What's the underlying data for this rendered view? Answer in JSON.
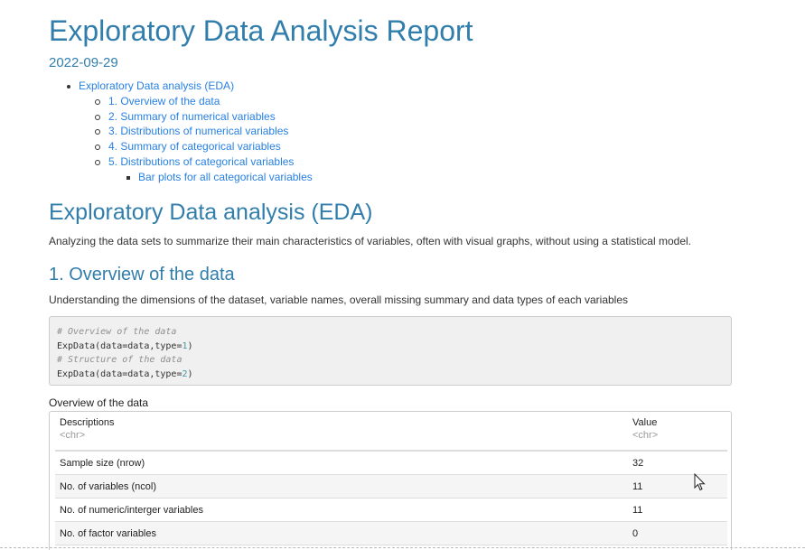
{
  "report": {
    "title": "Exploratory Data Analysis Report",
    "date": "2022-09-29"
  },
  "toc": {
    "top": "Exploratory Data analysis (EDA)",
    "items": [
      "1. Overview of the data",
      "2. Summary of numerical variables",
      "3. Distributions of numerical variables",
      "4. Summary of categorical variables",
      "5. Distributions of categorical variables"
    ],
    "sub": "Bar plots for all categorical variables"
  },
  "eda": {
    "heading": "Exploratory Data analysis (EDA)",
    "description": "Analyzing the data sets to summarize their main characteristics of variables, often with visual graphs, without using a statistical model."
  },
  "overview": {
    "heading": "1. Overview of the data",
    "description": "Understanding the dimensions of the dataset, variable names, overall missing summary and data types of each variables",
    "code": {
      "comment1": "# Overview of the data",
      "line1_fn": "ExpData(data=data,type=",
      "line1_num": "1",
      "line1_close": ")",
      "comment2": "# Structure of the data",
      "line2_fn": "ExpData(data=data,type=",
      "line2_num": "2",
      "line2_close": ")"
    },
    "table_caption": "Overview of the data",
    "table": {
      "headers": [
        {
          "name": "Descriptions",
          "type": "<chr>"
        },
        {
          "name": "Value",
          "type": "<chr>"
        }
      ],
      "rows": [
        [
          "Sample size (nrow)",
          "32"
        ],
        [
          "No. of variables (ncol)",
          "11"
        ],
        [
          "No. of numeric/interger variables",
          "11"
        ],
        [
          "No. of factor variables",
          "0"
        ]
      ]
    }
  },
  "colors": {
    "heading": "#317eac",
    "link": "#2780e3",
    "text": "#333333"
  }
}
